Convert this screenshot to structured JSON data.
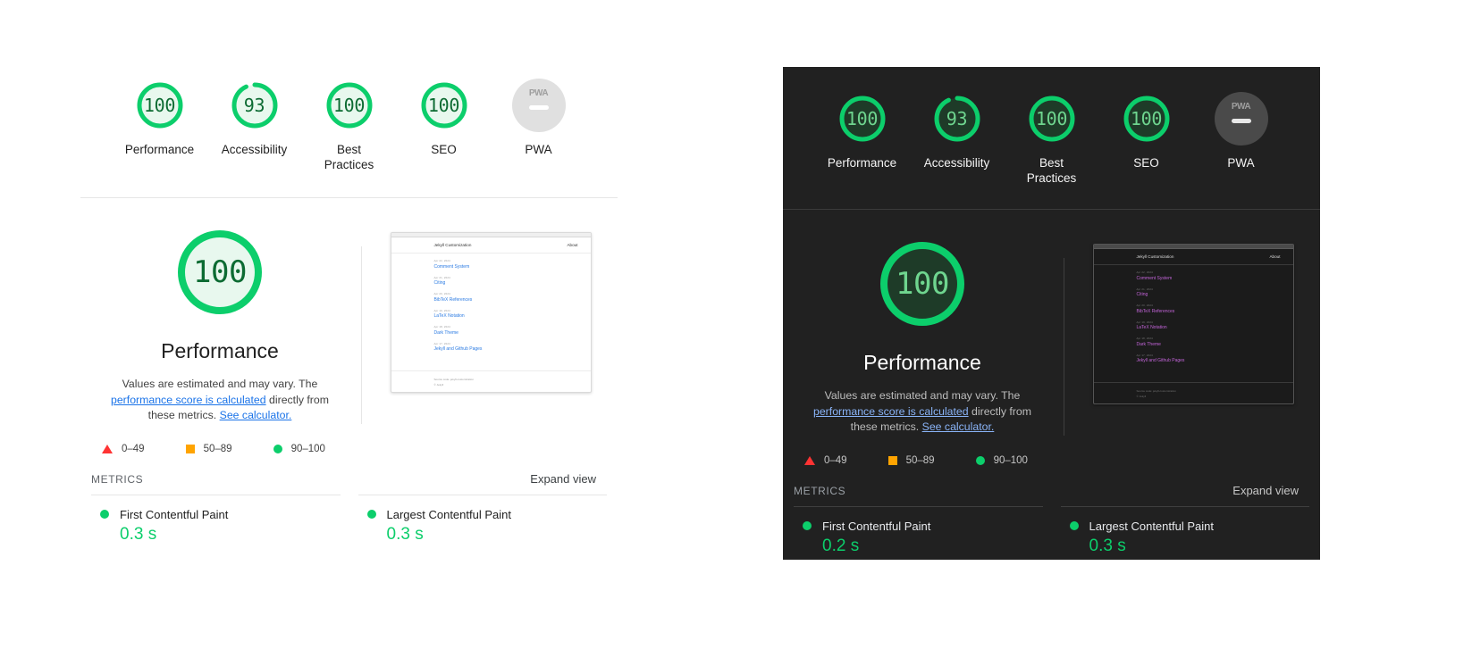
{
  "colors": {
    "pass": "#0cce6b",
    "average": "#ffa400",
    "fail": "#ff3333",
    "light_bg": "#ffffff",
    "dark_bg": "#212121",
    "light_link": "#1a73e8",
    "dark_link": "#8ab4f8",
    "gauge_fill_light": "#e8f8ee",
    "gauge_fill_dark": "#1e3b28"
  },
  "gauges": [
    {
      "name": "performance",
      "score": "100",
      "label": "Performance",
      "percent": 100
    },
    {
      "name": "accessibility",
      "score": "93",
      "label": "Accessibility",
      "percent": 93
    },
    {
      "name": "best-practices",
      "score": "100",
      "label": "Best\nPractices",
      "percent": 100
    },
    {
      "name": "seo",
      "score": "100",
      "label": "SEO",
      "percent": 100
    },
    {
      "name": "pwa",
      "score": "PWA",
      "label": "PWA",
      "percent": 0
    }
  ],
  "category": {
    "score": "100",
    "title": "Performance",
    "desc_part1": "Values are estimated and may vary. The ",
    "desc_link1": "performance score is calculated",
    "desc_part2": " directly from these metrics. ",
    "desc_link2": "See calculator."
  },
  "legend": [
    {
      "shape": "triangle",
      "range": "0–49"
    },
    {
      "shape": "square",
      "range": "50–89"
    },
    {
      "shape": "circle",
      "range": "90–100"
    }
  ],
  "metrics_section": {
    "title": "METRICS",
    "expand_label": "Expand view"
  },
  "metrics_light": [
    {
      "name": "First Contentful Paint",
      "value": "0.3 s",
      "status": "pass"
    },
    {
      "name": "Largest Contentful Paint",
      "value": "0.3 s",
      "status": "pass"
    }
  ],
  "metrics_dark": [
    {
      "name": "First Contentful Paint",
      "value": "0.2 s",
      "status": "pass"
    },
    {
      "name": "Largest Contentful Paint",
      "value": "0.3 s",
      "status": "pass"
    }
  ],
  "thumbnail": {
    "site_title": "Jekyll Customization",
    "nav_about": "About",
    "posts": [
      {
        "date": "Apr 22, 2024",
        "title": "Comment System"
      },
      {
        "date": "Apr 21, 2024",
        "title": "Citing"
      },
      {
        "date": "Apr 20, 2024",
        "title": "BibTeX References"
      },
      {
        "date": "Apr 19, 2024",
        "title": "LaTeX Notation"
      },
      {
        "date": "Apr 18, 2024",
        "title": "Dark Theme"
      },
      {
        "date": "Apr 17, 2024",
        "title": "Jekyll and Github Pages"
      }
    ],
    "footer_line1": "Source code: jekyll-customization",
    "footer_line2": "© Jekyll"
  }
}
